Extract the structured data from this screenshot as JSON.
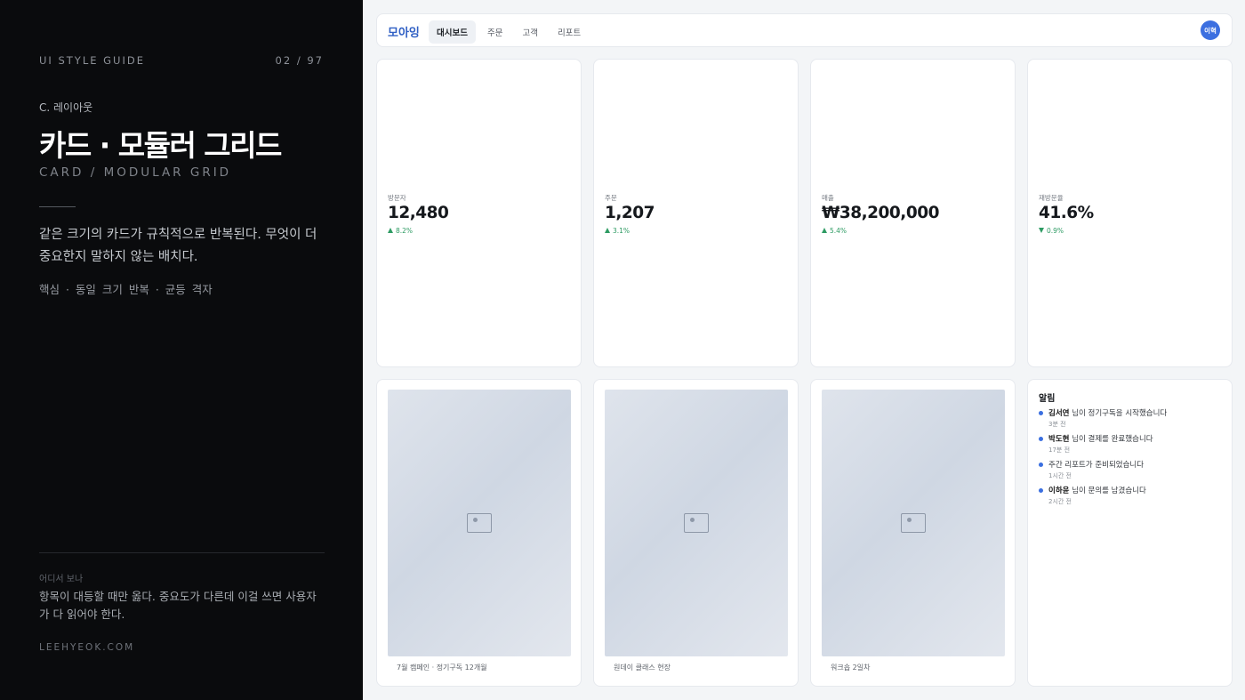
{
  "left": {
    "guide_label": "UI STYLE GUIDE",
    "page_counter": "02 / 97",
    "section": "C. 레이아웃",
    "title": "카드 · 모듈러 그리드",
    "subtitle": "CARD / MODULAR GRID",
    "description": "같은 크기의 카드가 규칙적으로 반복된다. 무엇이 더 중요한지 말하지 않는 배치다.",
    "core": "핵심 · 동일 크기 반복 · 균등 격자",
    "where_label": "어디서 보나",
    "where_desc": "항목이 대등할 때만 옳다. 중요도가 다른데 이걸 쓰면 사용자가 다 읽어야 한다.",
    "site": "LEEHYEOK.COM"
  },
  "nav": {
    "logo": "모아잉",
    "tabs": [
      {
        "label": "대시보드",
        "active": true
      },
      {
        "label": "주문",
        "active": false
      },
      {
        "label": "고객",
        "active": false
      },
      {
        "label": "리포트",
        "active": false
      }
    ],
    "avatar": "이혁"
  },
  "stats": [
    {
      "label": "방문자",
      "value": "12,480",
      "delta": "8.2%",
      "direction": "up"
    },
    {
      "label": "주문",
      "value": "1,207",
      "delta": "3.1%",
      "direction": "up"
    },
    {
      "label": "매출",
      "value": "₩38,200,000",
      "delta": "5.4%",
      "direction": "up"
    },
    {
      "label": "재방문율",
      "value": "41.6%",
      "delta": "0.9%",
      "direction": "down"
    }
  ],
  "images": [
    {
      "caption": "7월 캠페인 · 정기구독 12개월",
      "icon": "image-placeholder-icon"
    },
    {
      "caption": "원데이 클래스 현장",
      "icon": "image-placeholder-icon"
    },
    {
      "caption": "워크숍 2일차",
      "icon": "image-placeholder-icon"
    }
  ],
  "notifications": {
    "title": "알림",
    "items": [
      {
        "name": "김서연",
        "text": " 님이 정기구독을 시작했습니다",
        "time": "3분 전"
      },
      {
        "name": "박도현",
        "text": " 님이 결제를 완료했습니다",
        "time": "17분 전"
      },
      {
        "name": "",
        "text": "주간 리포트가 준비되었습니다",
        "time": "1시간 전"
      },
      {
        "name": "이하윤",
        "text": " 님이 문의를 남겼습니다",
        "time": "2시간 전"
      }
    ]
  },
  "colors": {
    "accent": "#3b6fe0",
    "logo": "#2f5fc4",
    "positive": "#2e9b63",
    "left_bg": "#0a0b0d"
  }
}
